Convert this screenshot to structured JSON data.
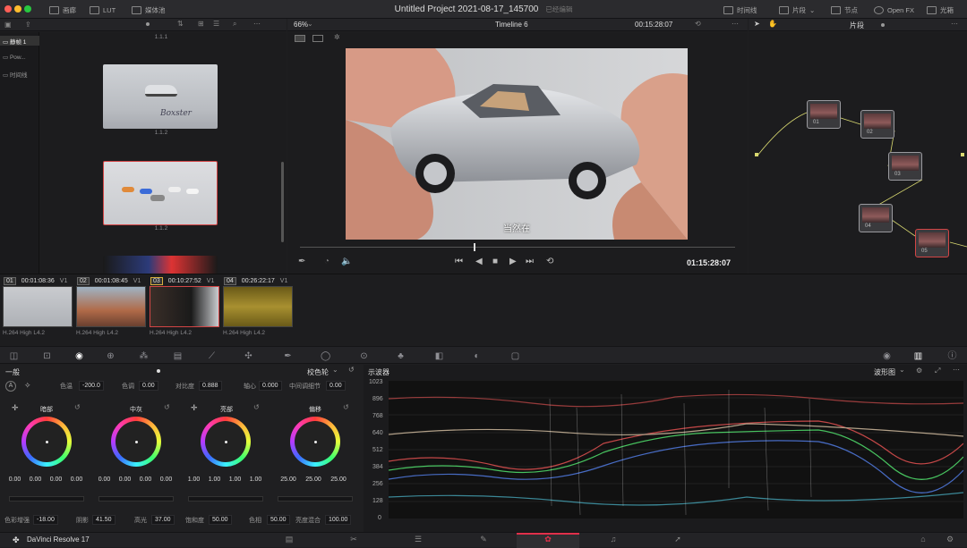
{
  "topbar": {
    "tabs": [
      "画廊",
      "LUT",
      "媒体池"
    ],
    "project_title": "Untitled Project 2021-08-17_145700",
    "edit_status": "已经编辑",
    "right_tabs": [
      "时间线",
      "片段",
      "节点",
      "Open FX",
      "光箱"
    ]
  },
  "media": {
    "sidebar": [
      "静帧 1",
      "Pow...",
      "时间线"
    ],
    "thumbs": [
      "1.1.1",
      "1.1.2",
      "1.1.2"
    ]
  },
  "viewer": {
    "zoom": "66%",
    "timeline": "Timeline 6",
    "timecode_top": "00:15:28:07",
    "timecode": "01:15:28:07",
    "subtitle": "当然在",
    "playhead_pct": 0.4
  },
  "nodes": {
    "header": "片段",
    "items": [
      "01",
      "02",
      "03",
      "04",
      "05"
    ]
  },
  "clips": [
    {
      "num": "01",
      "tc": "00:01:08:36",
      "track": "V1",
      "codec": "H.264 High L4.2"
    },
    {
      "num": "02",
      "tc": "00:01:08:45",
      "track": "V1",
      "codec": "H.264 High L4.2"
    },
    {
      "num": "03",
      "tc": "00:10:27:52",
      "track": "V1",
      "codec": "H.264 High L4.2"
    },
    {
      "num": "04",
      "tc": "00:26:22:17",
      "track": "V1",
      "codec": "H.264 High L4.2"
    }
  ],
  "color": {
    "section": "一般",
    "mode": "校色轮",
    "params_top": [
      {
        "label": "色温",
        "value": "-200.0"
      },
      {
        "label": "色调",
        "value": "0.00"
      },
      {
        "label": "对比度",
        "value": "0.888"
      },
      {
        "label": "轴心",
        "value": "0.000"
      },
      {
        "label": "中间调细节",
        "value": "0.00"
      }
    ],
    "wheels": [
      {
        "label": "暗部",
        "values": [
          "0.00",
          "0.00",
          "0.00",
          "0.00"
        ]
      },
      {
        "label": "中灰",
        "values": [
          "0.00",
          "0.00",
          "0.00",
          "0.00"
        ]
      },
      {
        "label": "亮部",
        "values": [
          "1.00",
          "1.00",
          "1.00",
          "1.00"
        ]
      },
      {
        "label": "偏移",
        "values": [
          "25.00",
          "25.00",
          "25.00"
        ]
      }
    ],
    "params_bottom": [
      {
        "label": "色彩增强",
        "value": "-18.00"
      },
      {
        "label": "阴影",
        "value": "41.50"
      },
      {
        "label": "高光",
        "value": "37.00"
      },
      {
        "label": "饱和度",
        "value": "50.00"
      },
      {
        "label": "色相",
        "value": "50.00"
      },
      {
        "label": "亮度混合",
        "value": "100.00"
      }
    ]
  },
  "scope": {
    "title": "示波器",
    "mode": "波形图",
    "ticks": [
      "1023",
      "896",
      "768",
      "640",
      "512",
      "384",
      "256",
      "128",
      "0"
    ]
  },
  "app": {
    "name": "DaVinci Resolve 17"
  }
}
